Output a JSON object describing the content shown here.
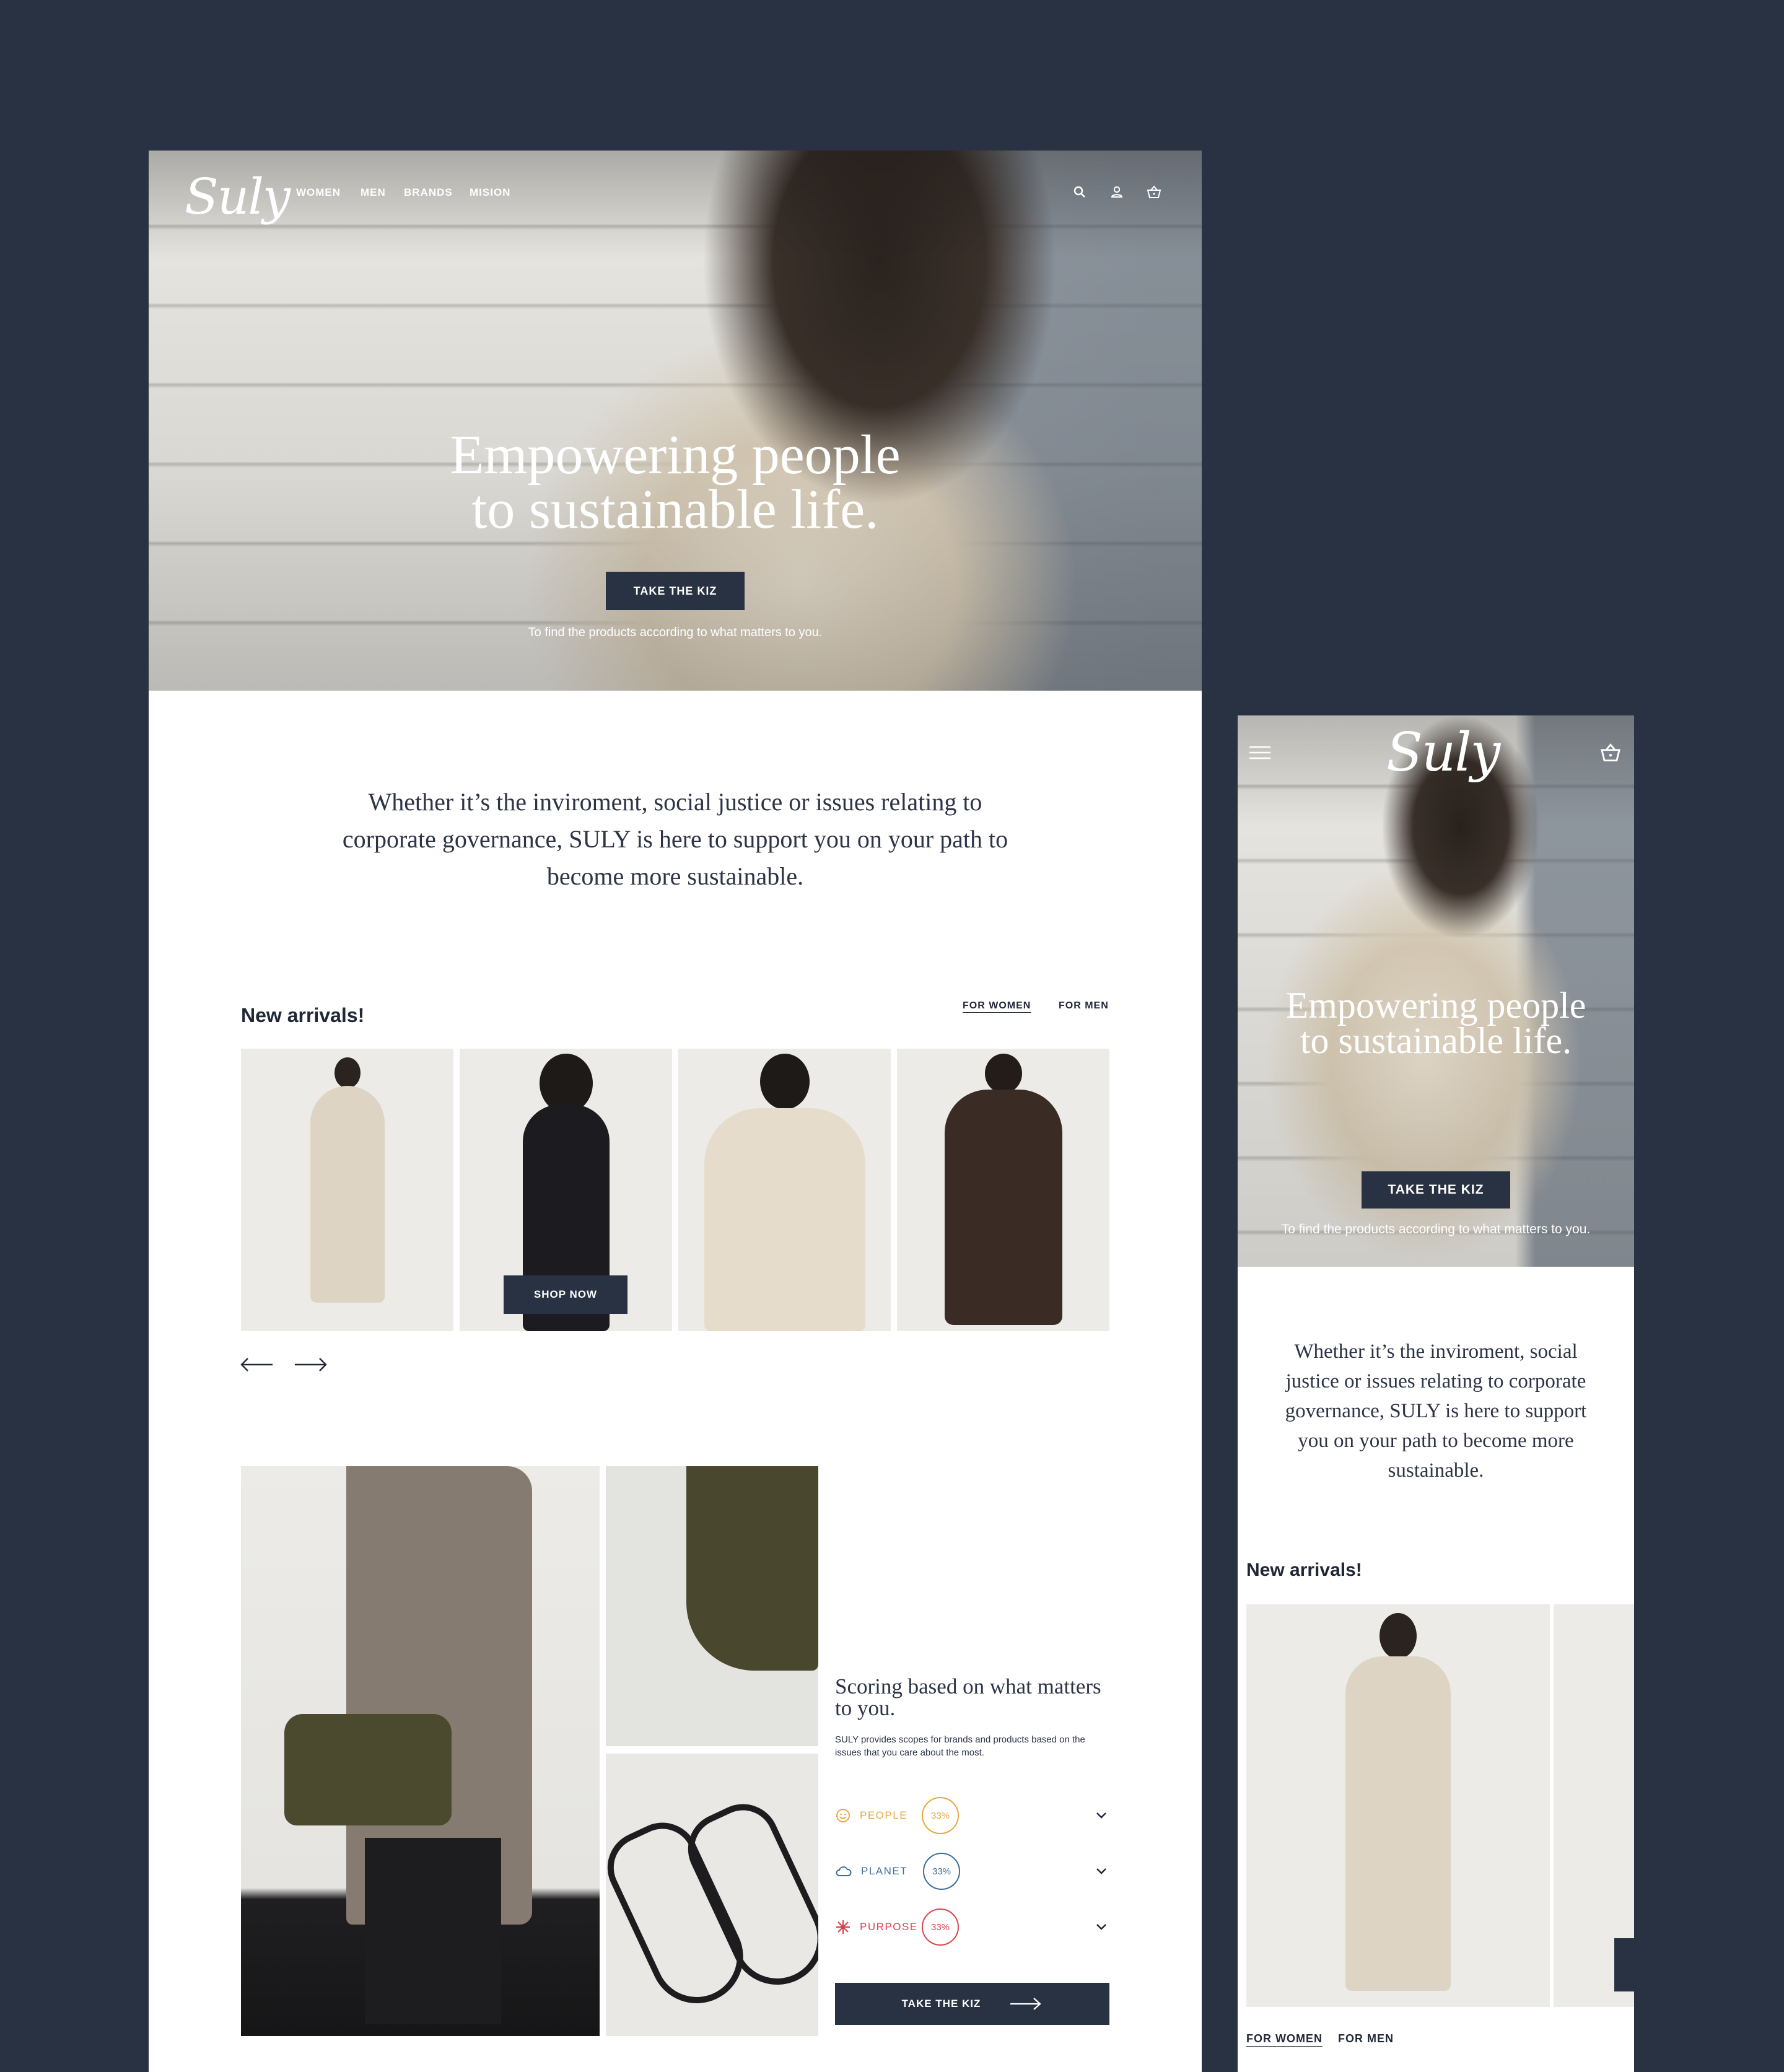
{
  "brand": {
    "logo": "Suly"
  },
  "nav": {
    "links": [
      "WOMEN",
      "MEN",
      "BRANDS",
      "MISION"
    ]
  },
  "hero": {
    "title_line1": "Empowering people",
    "title_line2": "to sustainable life.",
    "cta": "TAKE THE KIZ",
    "subtitle": "To find the products according to what matters to you."
  },
  "intro": {
    "text": "Whether it’s the inviroment, social justice or issues relating to corporate governance, SULY is here to support you on your path to become more sustainable."
  },
  "arrivals": {
    "title": "New arrivals!",
    "tabs": [
      "FOR WOMEN",
      "FOR MEN"
    ],
    "active_tab": "FOR WOMEN",
    "shop_now": "SHOP NOW"
  },
  "scoring": {
    "title": "Scoring based on what matters to you.",
    "description": "SULY provides scopes for brands and products based on the issues that you care about the most.",
    "rows": [
      {
        "label": "PEOPLE",
        "value": "33%",
        "color": "#e6a93e"
      },
      {
        "label": "PLANET",
        "value": "33%",
        "color": "#3d6e98"
      },
      {
        "label": "PURPOSE",
        "value": "33%",
        "color": "#d9454f"
      }
    ],
    "cta": "TAKE THE KIZ"
  },
  "colors": {
    "background": "#293242",
    "button": "#293242",
    "text_dark": "#1f2636"
  }
}
